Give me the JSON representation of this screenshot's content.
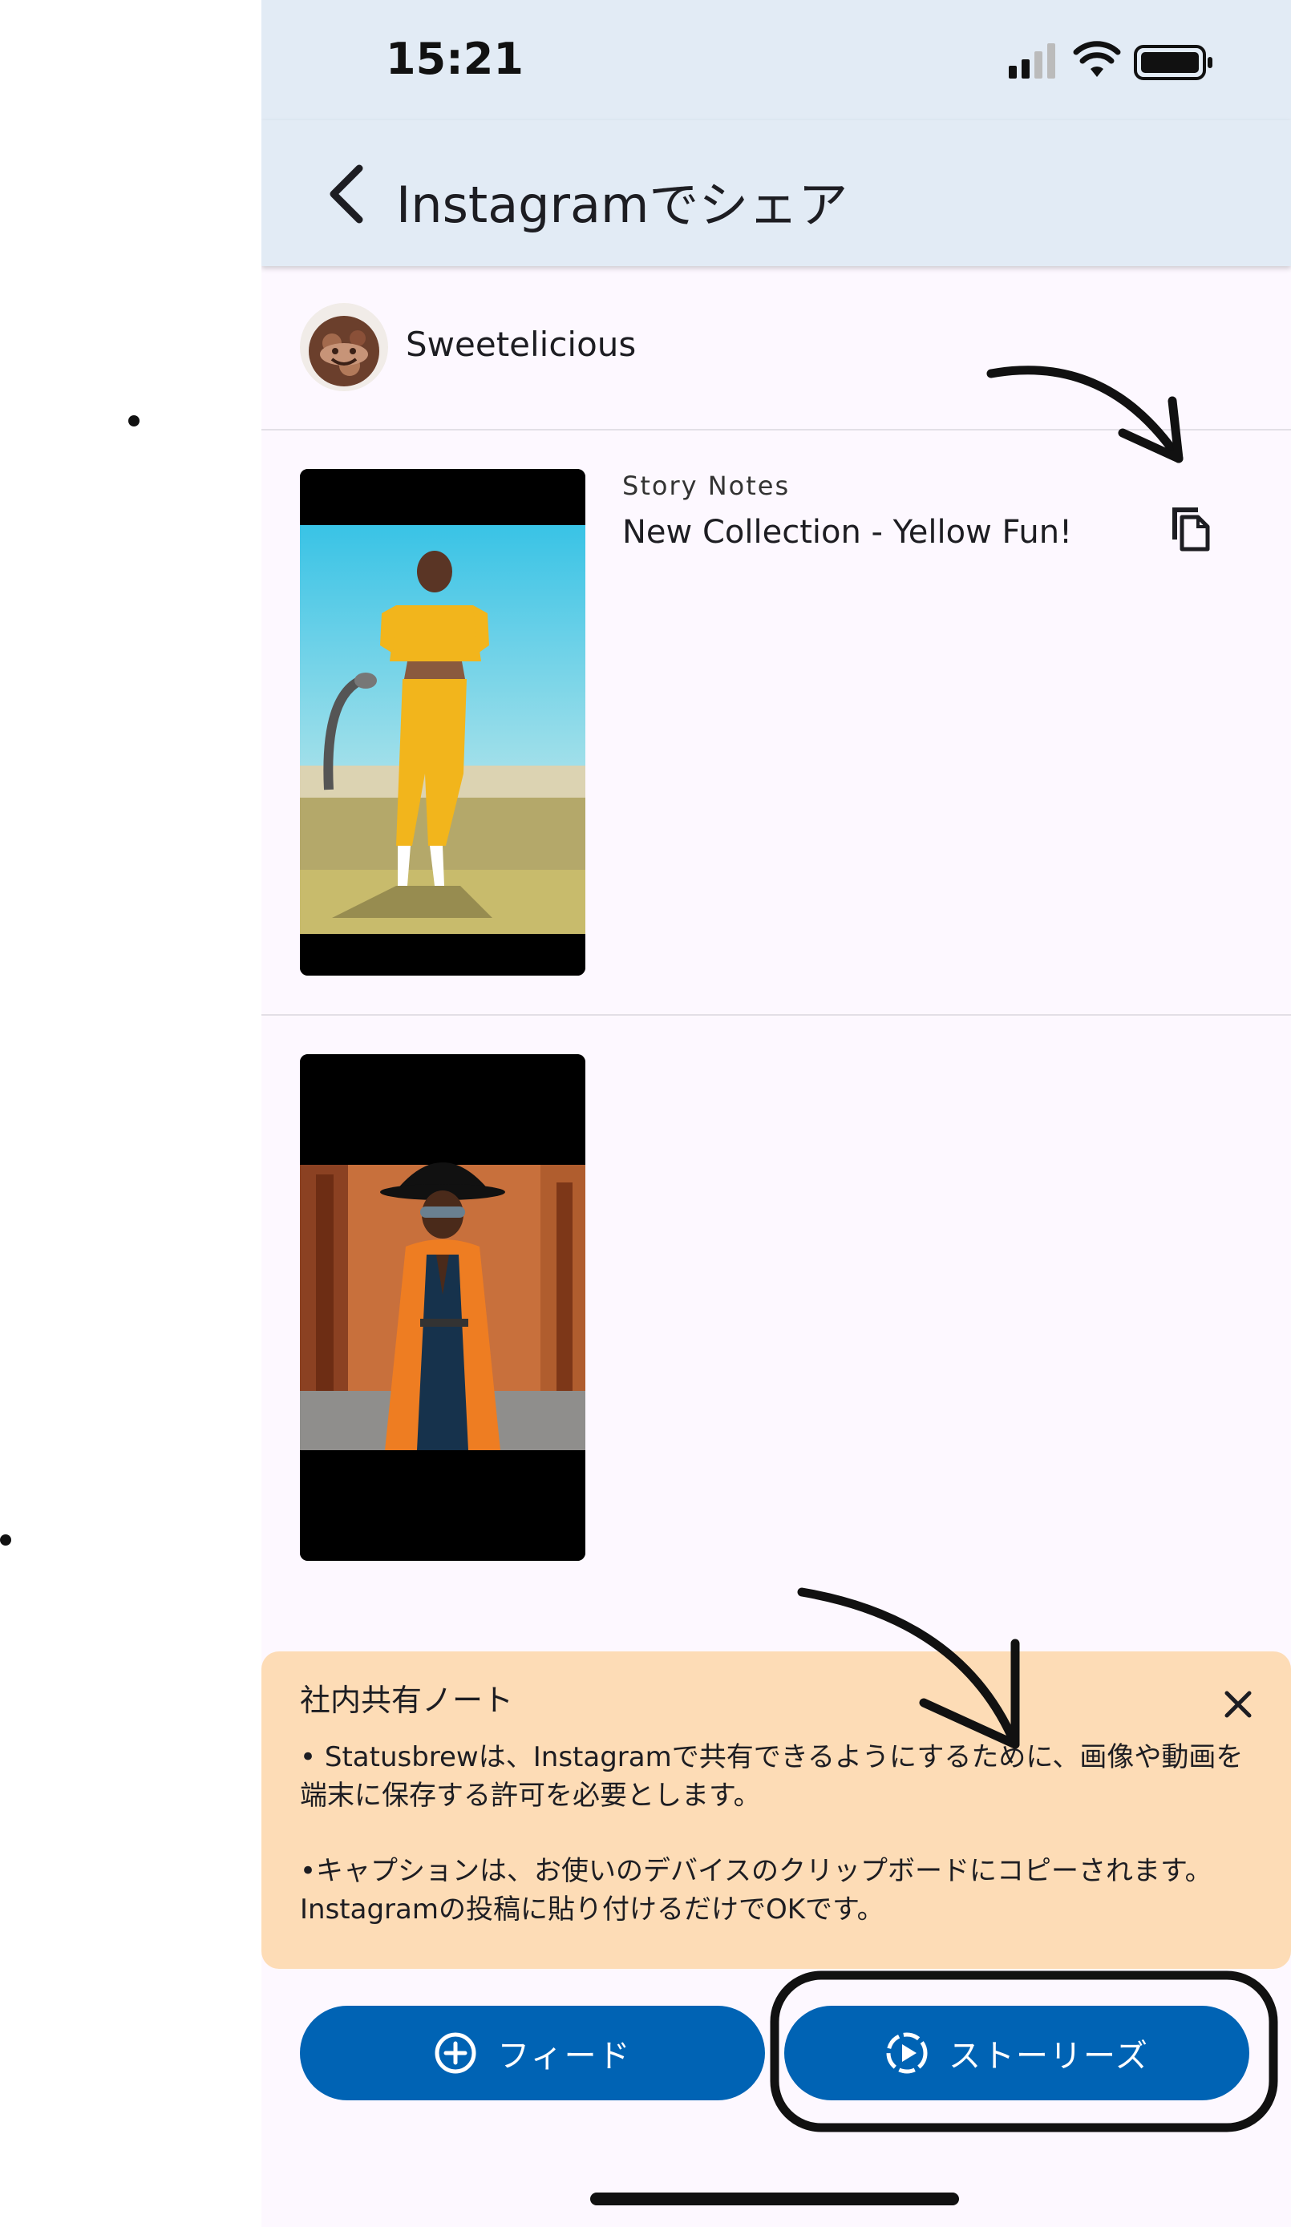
{
  "status_bar": {
    "time": "15:21"
  },
  "app_bar": {
    "title": "Instagramでシェア"
  },
  "account": {
    "name": "Sweetelicious"
  },
  "posts": [
    {
      "notes_label": "Story Notes",
      "notes_text": "New Collection - Yellow Fun!"
    },
    {}
  ],
  "notice": {
    "title": "社内共有ノート",
    "p1": "• Statusbrewは、Instagramで共有できるようにするために、画像や動画を端末に保存する許可を必要とします。",
    "p2": "•キャプションは、お使いのデバイスのクリップボードにコピーされます。Instagramの投稿に貼り付けるだけでOKです。"
  },
  "buttons": {
    "feed": "フィード",
    "stories": "ストーリーズ"
  },
  "colors": {
    "primary": "#0063b4",
    "app_bar_bg": "#e2ebf5",
    "notice_bg": "#fddcb6",
    "page_bg": "#fdf8ff"
  },
  "icons": {
    "back": "chevron-left-icon",
    "copy": "copy-icon",
    "close": "close-icon",
    "feed": "plus-circle-icon",
    "stories": "stories-play-icon",
    "signal": "signal-icon",
    "wifi": "wifi-icon",
    "battery": "battery-icon"
  }
}
